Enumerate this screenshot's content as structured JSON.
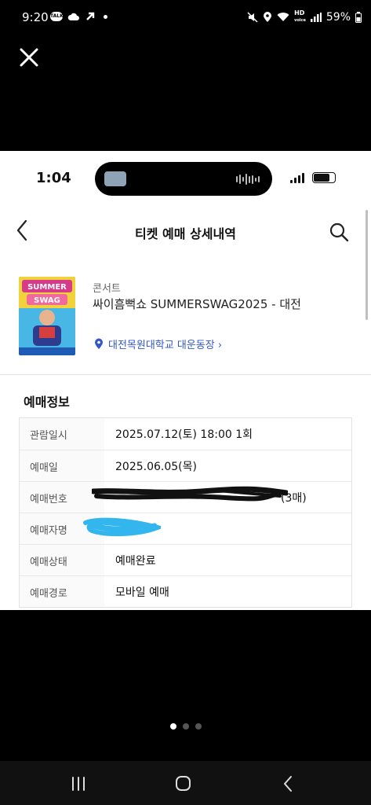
{
  "status_bar": {
    "time": "9:20",
    "battery": "59%",
    "icons": [
      "talk-icon",
      "cloud-icon",
      "link-icon",
      "dot-icon",
      "mute-icon",
      "location-icon",
      "wifi-icon",
      "hd-voice-icon",
      "signal-icon",
      "battery-icon"
    ]
  },
  "viewer": {
    "close_icon": "close-icon",
    "page_count": 3,
    "current_page": 1
  },
  "ios_status": {
    "time": "1:04",
    "battery_level": 0.8
  },
  "appbar": {
    "title": "티켓 예매 상세내역",
    "back_icon": "back-icon",
    "search_icon": "search-icon"
  },
  "event": {
    "category": "콘서트",
    "title": "싸이흠뻑쇼 SUMMERSWAG2025 - 대전",
    "venue": "대전목원대학교 대운동장 ›",
    "poster_text_top": "SUMMER",
    "poster_text_bottom": "SWAG"
  },
  "booking": {
    "section_title": "예매정보",
    "rows": [
      {
        "key": "관람일시",
        "value": "2025.07.12(토) 18:00 1회"
      },
      {
        "key": "예매일",
        "value": "2025.06.05(목)"
      },
      {
        "key": "예매번호",
        "value": "(3매)"
      },
      {
        "key": "예매자명",
        "value": ""
      },
      {
        "key": "예매상태",
        "value": "예매완료"
      },
      {
        "key": "예매경로",
        "value": "모바일 예매"
      }
    ]
  },
  "colors": {
    "accent": "#3257c9",
    "redaction_black": "#111111",
    "redaction_blue": "#33b6ee"
  }
}
